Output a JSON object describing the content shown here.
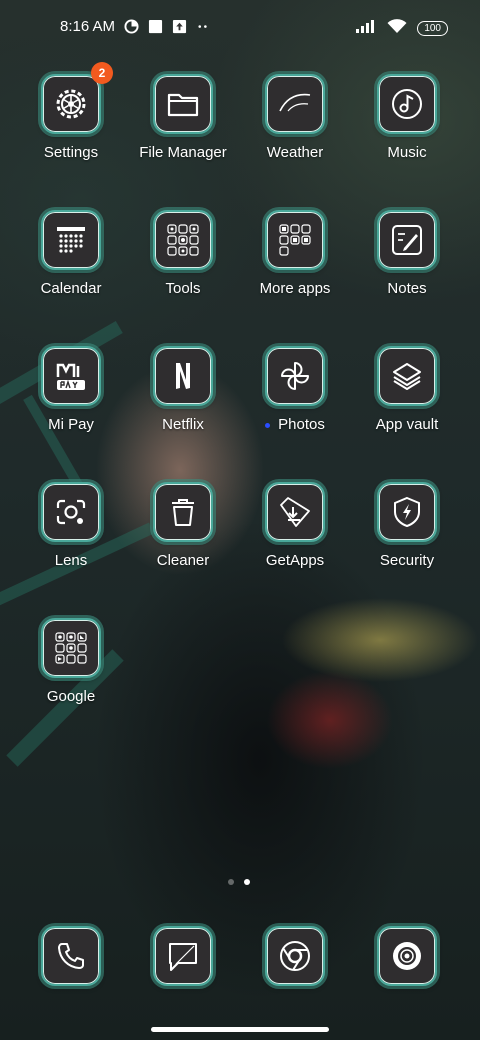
{
  "status_bar": {
    "time": "8:16 AM",
    "battery": "100",
    "left_icons": [
      "data-saver-icon",
      "square-notification-icon",
      "upload-notification-icon",
      "more-notifications-icon"
    ],
    "right_icons": [
      "signal-icon",
      "wifi-icon",
      "battery-icon"
    ]
  },
  "apps": [
    {
      "label": "Settings",
      "icon": "settings-icon",
      "badge": "2"
    },
    {
      "label": "File Manager",
      "icon": "folder-icon"
    },
    {
      "label": "Weather",
      "icon": "weather-icon"
    },
    {
      "label": "Music",
      "icon": "music-note-icon"
    },
    {
      "label": "Calendar",
      "icon": "calendar-icon"
    },
    {
      "label": "Tools",
      "icon": "tools-folder-icon"
    },
    {
      "label": "More apps",
      "icon": "more-apps-folder-icon"
    },
    {
      "label": "Notes",
      "icon": "notes-icon"
    },
    {
      "label": "Mi Pay",
      "icon": "mi-pay-icon"
    },
    {
      "label": "Netflix",
      "icon": "netflix-icon"
    },
    {
      "label": "Photos",
      "icon": "pinwheel-icon",
      "new_dot": true
    },
    {
      "label": "App vault",
      "icon": "layers-icon"
    },
    {
      "label": "Lens",
      "icon": "lens-camera-icon"
    },
    {
      "label": "Cleaner",
      "icon": "trash-icon"
    },
    {
      "label": "GetApps",
      "icon": "download-tray-icon"
    },
    {
      "label": "Security",
      "icon": "shield-bolt-icon"
    },
    {
      "label": "Google",
      "icon": "google-folder-icon"
    }
  ],
  "pager": {
    "pages": 2,
    "active": 2
  },
  "dock": [
    {
      "name": "phone",
      "icon": "phone-icon"
    },
    {
      "name": "messages",
      "icon": "message-icon"
    },
    {
      "name": "chrome",
      "icon": "chrome-icon"
    },
    {
      "name": "camera",
      "icon": "camera-icon"
    }
  ],
  "colors": {
    "icon_bg": "#2f2d2f",
    "icon_border": "#4aa89a",
    "badge": "#f25a1f",
    "new_dot": "#2a4dff"
  }
}
